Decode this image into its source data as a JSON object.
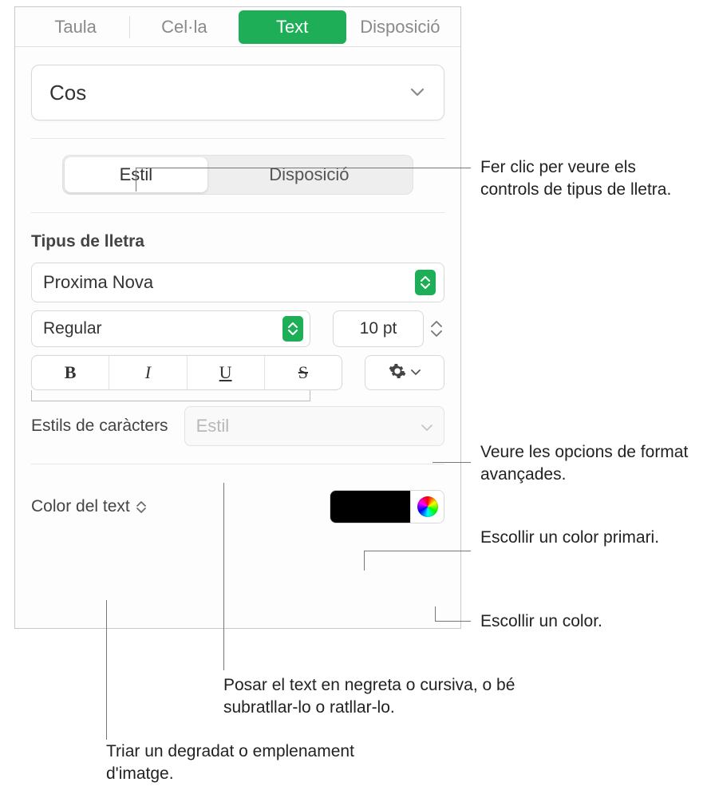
{
  "tabs": {
    "taula": "Taula",
    "cella": "Cel·la",
    "text": "Text",
    "disposicio": "Disposició"
  },
  "paragraph_style": "Cos",
  "segmented": {
    "estil": "Estil",
    "disposicio": "Disposició"
  },
  "font_section_label": "Tipus de lletra",
  "font_family": "Proxima Nova",
  "font_weight": "Regular",
  "font_size": "10 pt",
  "bius": {
    "b": "B",
    "i": "I",
    "u": "U",
    "s": "S"
  },
  "char_styles_label": "Estils de caràcters",
  "char_styles_placeholder": "Estil",
  "text_color_label": "Color del text",
  "callouts": {
    "estil": "Fer clic per veure els controls de tipus de lletra.",
    "gear": "Veure les opcions de format avançades.",
    "primary_color": "Escollir un color primari.",
    "color": "Escollir un color.",
    "bius": "Posar el text en negreta o cursiva, o bé subratllar-lo o ratllar-lo.",
    "gradient": "Triar un degradat o emplenament d'imatge."
  }
}
